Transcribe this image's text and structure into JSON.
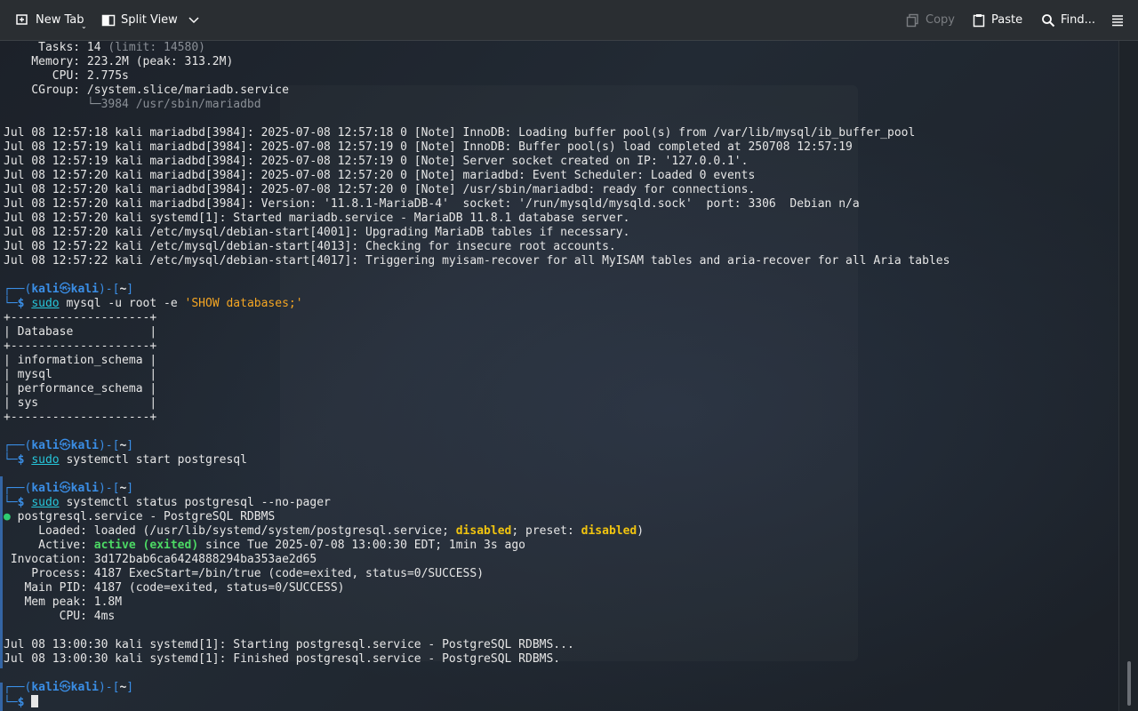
{
  "toolbar": {
    "new_tab": "New Tab",
    "split_view": "Split View",
    "copy": "Copy",
    "paste": "Paste",
    "find": "Find..."
  },
  "terminal": {
    "lines": [
      [
        "",
        "     Tasks: 14 ",
        "(limit: 14580)"
      ],
      [
        "    Memory: 223.2M (peak: 313.2M)"
      ],
      [
        "       CPU: 2.775s"
      ],
      [
        "    CGroup: /system.slice/mariadb.service"
      ],
      [
        "            └─3984 /usr/sbin/mariadbd"
      ],
      [
        ""
      ],
      [
        "Jul 08 12:57:18 kali mariadbd[3984]: 2025-07-08 12:57:18 0 [Note] InnoDB: Loading buffer pool(s) from /var/lib/mysql/ib_buffer_pool"
      ],
      [
        "Jul 08 12:57:19 kali mariadbd[3984]: 2025-07-08 12:57:19 0 [Note] InnoDB: Buffer pool(s) load completed at 250708 12:57:19"
      ],
      [
        "Jul 08 12:57:19 kali mariadbd[3984]: 2025-07-08 12:57:19 0 [Note] Server socket created on IP: '127.0.0.1'."
      ],
      [
        "Jul 08 12:57:20 kali mariadbd[3984]: 2025-07-08 12:57:20 0 [Note] mariadbd: Event Scheduler: Loaded 0 events"
      ],
      [
        "Jul 08 12:57:20 kali mariadbd[3984]: 2025-07-08 12:57:20 0 [Note] /usr/sbin/mariadbd: ready for connections."
      ],
      [
        "Jul 08 12:57:20 kali mariadbd[3984]: Version: '11.8.1-MariaDB-4'  socket: '/run/mysqld/mysqld.sock'  port: 3306  Debian n/a"
      ],
      [
        "Jul 08 12:57:20 kali systemd[1]: Started mariadb.service - MariaDB 11.8.1 database server."
      ],
      [
        "Jul 08 12:57:20 kali /etc/mysql/debian-start[4001]: Upgrading MariaDB tables if necessary."
      ],
      [
        "Jul 08 12:57:22 kali /etc/mysql/debian-start[4013]: Checking for insecure root accounts."
      ],
      [
        "Jul 08 12:57:22 kali /etc/mysql/debian-start[4017]: Triggering myisam-recover for all MyISAM tables and aria-recover for all Aria tables"
      ]
    ],
    "prompt": {
      "user": "kali",
      "host": "kali",
      "dir": "~",
      "dollar": "$"
    },
    "cmd1": {
      "sudo": "sudo",
      "rest": " mysql -u root -e ",
      "arg": "'SHOW databases;'"
    },
    "table": [
      "+--------------------+",
      "| Database           |",
      "+--------------------+",
      "| information_schema |",
      "| mysql              |",
      "| performance_schema |",
      "| sys                |",
      "+--------------------+"
    ],
    "cmd2": {
      "sudo": "sudo",
      "rest": " systemctl start postgresql"
    },
    "cmd3": {
      "sudo": "sudo",
      "rest": " systemctl status postgresql --no-pager"
    },
    "status": {
      "dot": "●",
      "service": " postgresql.service - PostgreSQL RDBMS",
      "loaded_pre": "     Loaded: loaded (/usr/lib/systemd/system/postgresql.service; ",
      "disabled1": "disabled",
      "loaded_mid": "; preset: ",
      "disabled2": "disabled",
      "loaded_end": ")",
      "active_pre": "     Active: ",
      "active_val": "active (exited)",
      "active_end": " since Tue 2025-07-08 13:00:30 EDT; 1min 3s ago",
      "rest": [
        " Invocation: 3d172bab6ca6424888294ba353ae2d65",
        "    Process: 4187 ExecStart=/bin/true (code=exited, status=0/SUCCESS)",
        "   Main PID: 4187 (code=exited, status=0/SUCCESS)",
        "   Mem peak: 1.8M",
        "        CPU: 4ms"
      ]
    },
    "final_logs": [
      "Jul 08 13:00:30 kali systemd[1]: Starting postgresql.service - PostgreSQL RDBMS...",
      "Jul 08 13:00:30 kali systemd[1]: Finished postgresql.service - PostgreSQL RDBMS."
    ]
  },
  "colors": {
    "prompt_blue": "#3a8ee6",
    "accent": "#3465a4"
  }
}
